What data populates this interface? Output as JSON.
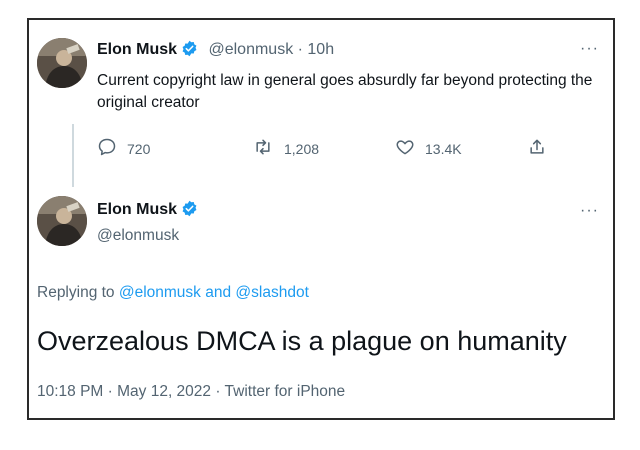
{
  "tweet1": {
    "name": "Elon Musk",
    "handle": "@elonmusk",
    "time": " · 10h",
    "text": "Current copyright law in general goes absurdly far beyond protecting the original creator",
    "more": "···",
    "actions": {
      "replies": "720",
      "retweets": "1,208",
      "likes": "13.4K"
    }
  },
  "tweet2": {
    "name": "Elon Musk",
    "handle": "@elonmusk",
    "more": "···",
    "replying_prefix": "Replying to ",
    "replying_user1": "@elonmusk",
    "replying_and": " and ",
    "replying_user2": "@slashdot",
    "text": "Overzealous DMCA is a plague on humanity",
    "timestamp": "10:18 PM · May 12, 2022 · Twitter for iPhone"
  },
  "colors": {
    "verified": "#1d9bf0",
    "link": "#1d9bf0",
    "secondary_text": "#536471"
  },
  "icons": [
    "verified-badge-icon",
    "reply-icon",
    "retweet-icon",
    "like-icon",
    "share-icon",
    "more-icon"
  ]
}
